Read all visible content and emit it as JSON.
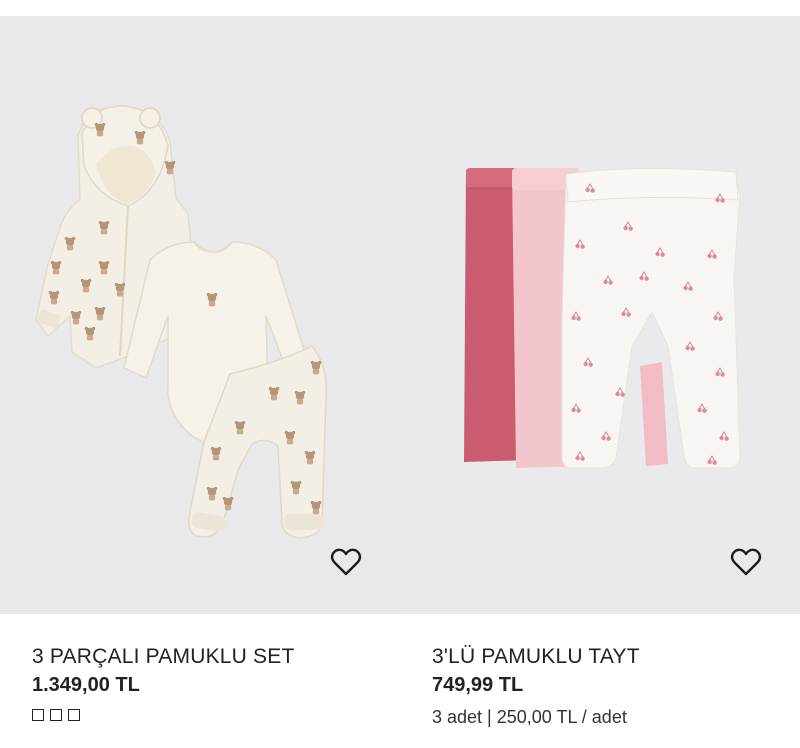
{
  "products": [
    {
      "title": "3 PARÇALI PAMUKLU SET",
      "price": "1.349,00 TL",
      "swatch_count": 3,
      "image_alt": "three-piece cream baby set with bear print hoodie, bodysuit and pants",
      "favorite_icon": "heart-outline-icon"
    },
    {
      "title": "3'LÜ PAMUKLU TAYT",
      "price": "749,99 TL",
      "unit_price": "3 adet | 250,00 TL / adet",
      "image_alt": "three leggings in dark pink, light pink and white with cherry print",
      "favorite_icon": "heart-outline-icon"
    }
  ],
  "colors": {
    "image_bg": "#e9e9eb",
    "text": "#222222",
    "legging_dark": "#c75d6e",
    "legging_light": "#f2c4cb",
    "legging_white": "#f8f6f2",
    "cream": "#f3eee4",
    "bear_print": "#b49579"
  }
}
